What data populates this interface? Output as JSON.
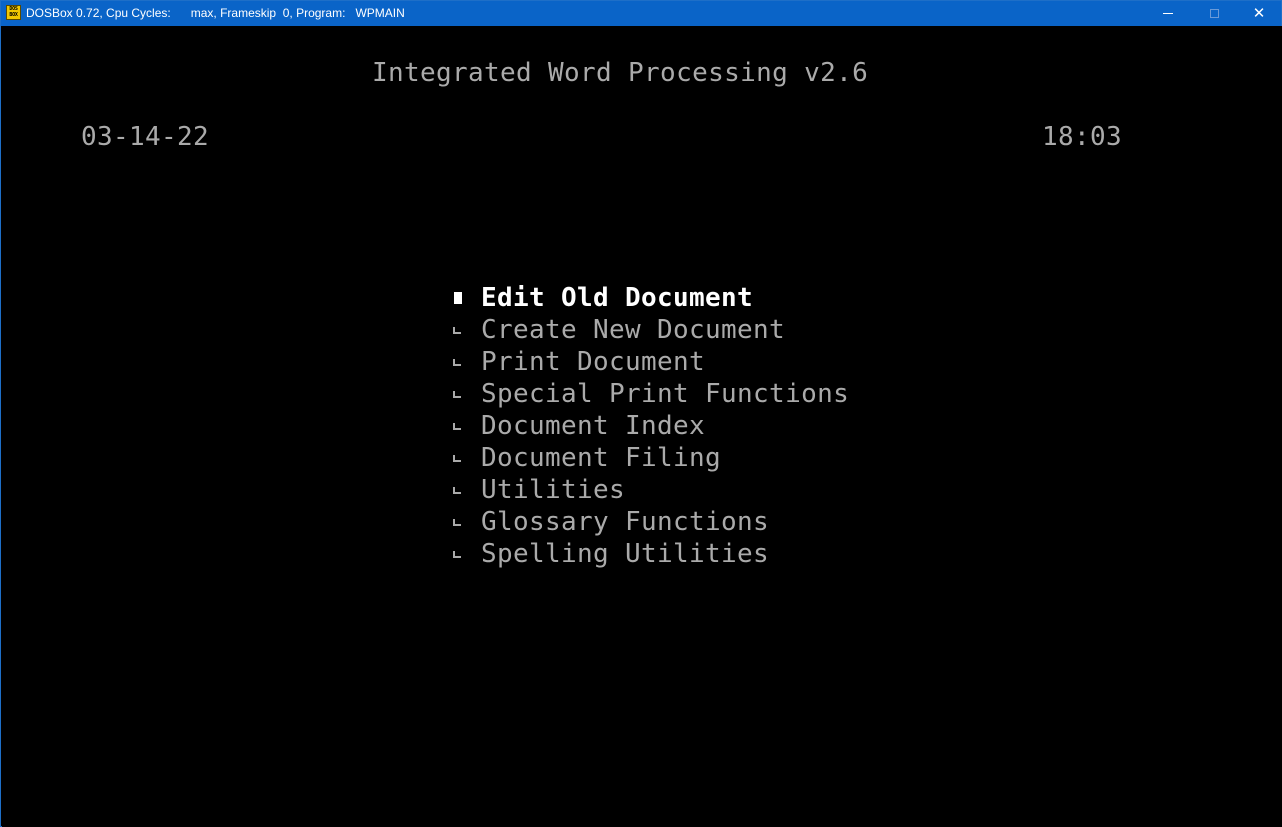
{
  "window": {
    "title": "DOSBox 0.72, Cpu Cycles:      max, Frameskip  0, Program:   WPMAIN",
    "icon": "dosbox-icon",
    "icon_text": [
      "DOS",
      "BOX"
    ],
    "accent_color": "#0a64c8"
  },
  "screen": {
    "app_title": "Integrated Word Processing v2.6",
    "date": "03-14-22",
    "time": "18:03",
    "text_color": "#aaaaaa",
    "highlight_color": "#ffffff"
  },
  "menu": {
    "selected_index": 0,
    "items": [
      {
        "label": "Edit Old Document"
      },
      {
        "label": "Create New Document"
      },
      {
        "label": "Print Document"
      },
      {
        "label": "Special Print Functions"
      },
      {
        "label": "Document Index"
      },
      {
        "label": "Document Filing"
      },
      {
        "label": "Utilities"
      },
      {
        "label": "Glossary Functions"
      },
      {
        "label": "Spelling Utilities"
      }
    ]
  }
}
